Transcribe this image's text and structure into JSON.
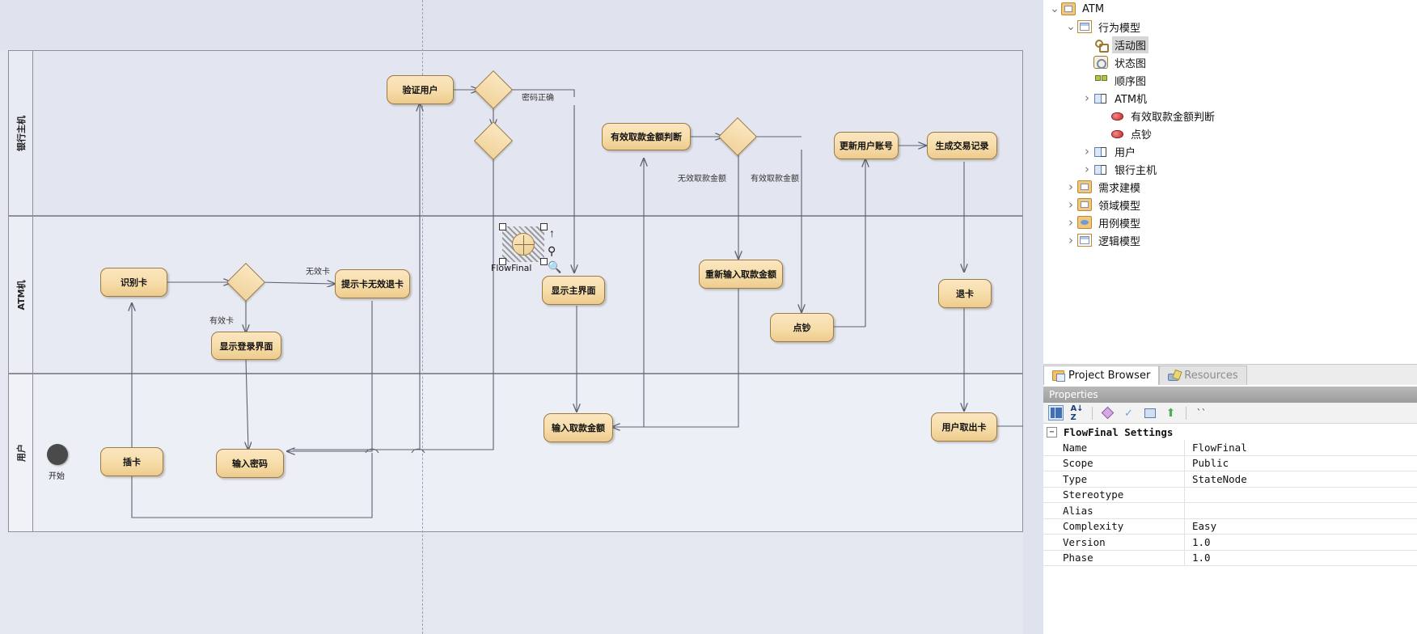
{
  "diagram": {
    "lanes": [
      {
        "title": "银行主机"
      },
      {
        "title": "ATM机"
      },
      {
        "title": "用户"
      }
    ],
    "start_label": "开始",
    "nodes": [
      {
        "id": "verify-user",
        "label": "验证用户"
      },
      {
        "id": "valid-amount-judge",
        "label": "有效取款金额判断"
      },
      {
        "id": "update-account",
        "label": "更新用户账号"
      },
      {
        "id": "gen-trans-record",
        "label": "生成交易记录"
      },
      {
        "id": "identify-card",
        "label": "识别卡"
      },
      {
        "id": "prompt-invalid-card",
        "label": "提示卡无效退卡"
      },
      {
        "id": "show-main-ui",
        "label": "显示主界面"
      },
      {
        "id": "reenter-amount",
        "label": "重新输入取款金额"
      },
      {
        "id": "count-cash",
        "label": "点钞"
      },
      {
        "id": "eject-card",
        "label": "退卡"
      },
      {
        "id": "show-login-ui",
        "label": "显示登录界面"
      },
      {
        "id": "insert-card",
        "label": "插卡"
      },
      {
        "id": "enter-password",
        "label": "输入密码"
      },
      {
        "id": "enter-amount",
        "label": "输入取款金额"
      },
      {
        "id": "user-take-card",
        "label": "用户取出卡"
      }
    ],
    "edge_labels": [
      {
        "id": "password-correct",
        "text": "密码正确"
      },
      {
        "id": "invalid-card",
        "text": "无效卡"
      },
      {
        "id": "valid-card",
        "text": "有效卡"
      },
      {
        "id": "invalid-amount",
        "text": "无效取款金额"
      },
      {
        "id": "valid-amount",
        "text": "有效取款金额"
      }
    ],
    "flow_final": {
      "label": "FlowFinal",
      "quick_link_icons": [
        "arrow-up-icon",
        "pin-icon",
        "magnifier-icon"
      ]
    }
  },
  "tree": {
    "items": [
      {
        "label": "ATM",
        "indent": 0,
        "expander": "v",
        "icon": "package-icon",
        "selected": false
      },
      {
        "label": "行为模型",
        "indent": 1,
        "expander": "v",
        "icon": "document-icon",
        "selected": false
      },
      {
        "label": "活动图",
        "indent": 2,
        "expander": "",
        "icon": "activity-diagram-icon",
        "selected": true
      },
      {
        "label": "状态图",
        "indent": 2,
        "expander": "",
        "icon": "state-diagram-icon",
        "selected": false
      },
      {
        "label": "顺序图",
        "indent": 2,
        "expander": "",
        "icon": "sequence-diagram-icon",
        "selected": false
      },
      {
        "label": "ATM机",
        "indent": 2,
        "expander": ">",
        "icon": "class-icon",
        "selected": false
      },
      {
        "label": "有效取款金额判断",
        "indent": 3,
        "expander": "",
        "icon": "operation-icon",
        "selected": false
      },
      {
        "label": "点钞",
        "indent": 3,
        "expander": "",
        "icon": "operation-icon",
        "selected": false
      },
      {
        "label": "用户",
        "indent": 2,
        "expander": ">",
        "icon": "class-icon",
        "selected": false
      },
      {
        "label": "银行主机",
        "indent": 2,
        "expander": ">",
        "icon": "class-icon",
        "selected": false
      },
      {
        "label": "需求建模",
        "indent": 1,
        "expander": ">",
        "icon": "package-icon",
        "selected": false
      },
      {
        "label": "领域模型",
        "indent": 1,
        "expander": ">",
        "icon": "package-icon",
        "selected": false
      },
      {
        "label": "用例模型",
        "indent": 1,
        "expander": ">",
        "icon": "usecase-icon",
        "selected": false
      },
      {
        "label": "逻辑模型",
        "indent": 1,
        "expander": ">",
        "icon": "document-icon",
        "selected": false
      }
    ]
  },
  "tabs": [
    {
      "id": "project-browser",
      "label": "Project Browser",
      "active": true,
      "icon": "folder-icon"
    },
    {
      "id": "resources",
      "label": "Resources",
      "active": false,
      "icon": "resources-icon"
    }
  ],
  "properties": {
    "title": "Properties",
    "toolbar": [
      {
        "id": "categorized",
        "icon": "categorized-icon"
      },
      {
        "id": "alphabetical",
        "icon": "sort-az-icon"
      },
      {
        "id": "diamond",
        "icon": "diamond-icon"
      },
      {
        "id": "check",
        "icon": "check-icon"
      },
      {
        "id": "image",
        "icon": "image-icon"
      },
      {
        "id": "up",
        "icon": "arrow-up-icon"
      },
      {
        "id": "glasses",
        "icon": "glasses-icon"
      }
    ],
    "group": "FlowFinal Settings",
    "rows": [
      {
        "key": "Name",
        "value": "FlowFinal"
      },
      {
        "key": "Scope",
        "value": "Public"
      },
      {
        "key": "Type",
        "value": "StateNode"
      },
      {
        "key": "Stereotype",
        "value": ""
      },
      {
        "key": "Alias",
        "value": ""
      },
      {
        "key": "Complexity",
        "value": "Easy"
      },
      {
        "key": "Version",
        "value": "1.0"
      },
      {
        "key": "Phase",
        "value": "1.0"
      }
    ]
  }
}
